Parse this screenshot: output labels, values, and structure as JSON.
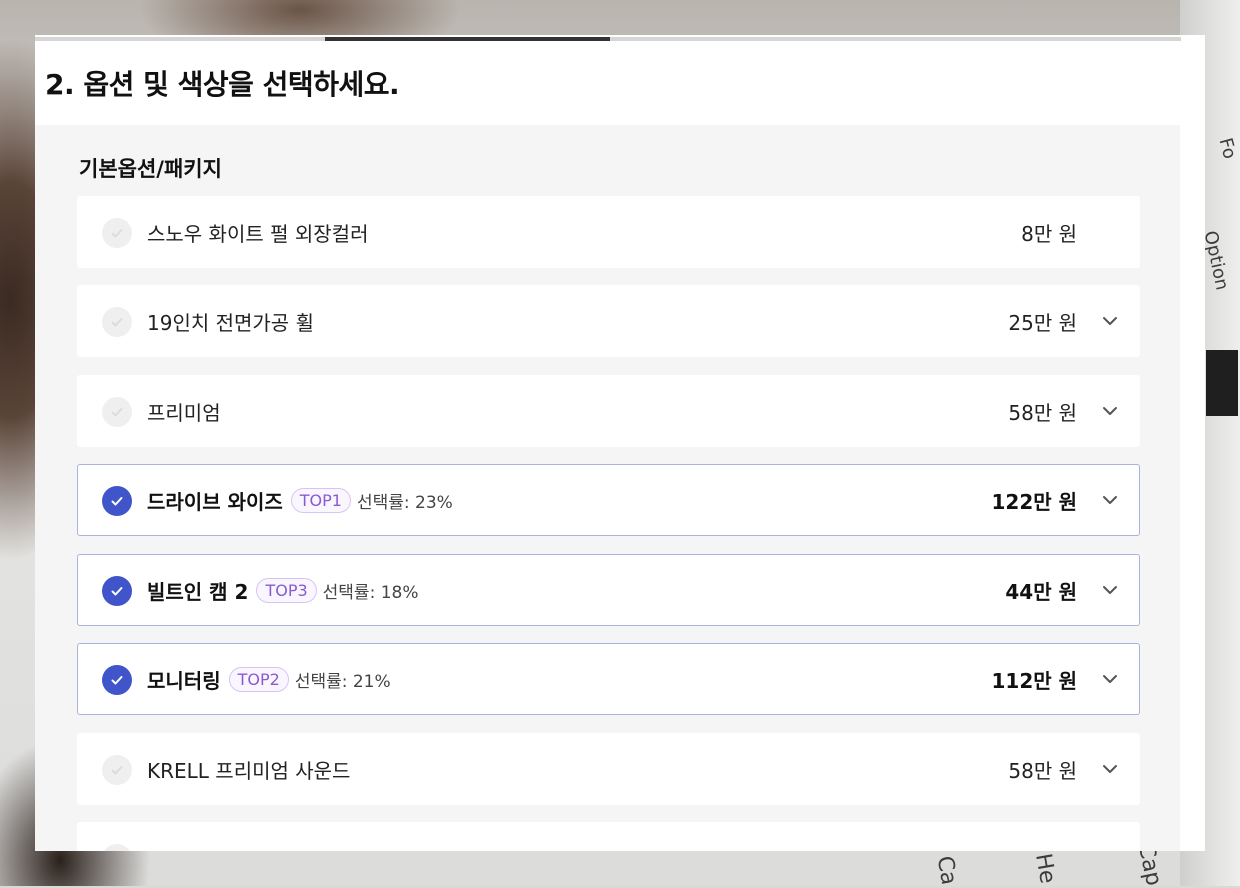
{
  "background": {
    "words": [
      "Ca",
      "He",
      "Cap",
      "Option",
      "Fo"
    ]
  },
  "progress": {
    "current_step": 2,
    "fraction_start": 0.26,
    "fraction_end": 0.51
  },
  "page": {
    "title": "2. 옵션 및 색상을 선택하세요."
  },
  "section": {
    "title": "기본옵션/패키지"
  },
  "colors": {
    "accent": "#3f55c9",
    "badge": "#8a5ad0",
    "selected_border": "#aab3dc"
  },
  "options": [
    {
      "name": "스노우 화이트 펄 외장컬러",
      "price": "8만 원",
      "selected": false,
      "expandable": false
    },
    {
      "name": "19인치 전면가공 휠",
      "price": "25만 원",
      "selected": false,
      "expandable": true
    },
    {
      "name": "프리미엄",
      "price": "58만 원",
      "selected": false,
      "expandable": true
    },
    {
      "name": "드라이브 와이즈",
      "badge": "TOP1",
      "rate": "선택률: 23%",
      "price": "122만 원",
      "selected": true,
      "expandable": true
    },
    {
      "name": "빌트인 캠 2",
      "badge": "TOP3",
      "rate": "선택률: 18%",
      "price": "44만 원",
      "selected": true,
      "expandable": true
    },
    {
      "name": "모니터링",
      "badge": "TOP2",
      "rate": "선택률: 21%",
      "price": "112만 원",
      "selected": true,
      "expandable": true
    },
    {
      "name": "KRELL 프리미엄 사운드",
      "price": "58만 원",
      "selected": false,
      "expandable": true
    }
  ]
}
